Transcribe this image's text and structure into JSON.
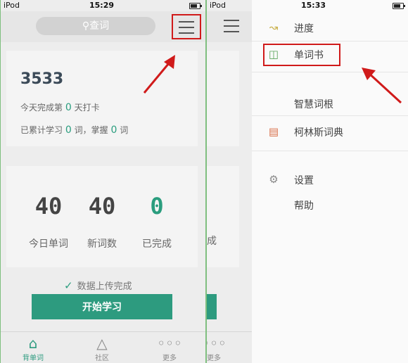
{
  "screens": {
    "main": {
      "status": {
        "left": "iPod",
        "time": "15:29"
      },
      "search": {
        "placeholder": "查词"
      },
      "card1": {
        "total": "3533",
        "streak_prefix": "今天完成第",
        "streak_days": "0",
        "streak_suffix": "天打卡",
        "learned_prefix": "已累计学习",
        "learned_count": "0",
        "learned_unit": "词，掌握",
        "mastered_count": "0",
        "mastered_unit": "词"
      },
      "stats": [
        {
          "value": "40",
          "label": "今日单词"
        },
        {
          "value": "40",
          "label": "新词数"
        },
        {
          "value": "0",
          "label": "已完成"
        }
      ],
      "upload_text": "数据上传完成",
      "start_button": "开始学习",
      "tabs": [
        {
          "label": "背单词",
          "icon": "home-icon"
        },
        {
          "label": "社区",
          "icon": "community-icon"
        },
        {
          "label": "更多",
          "icon": "more-icon"
        }
      ]
    },
    "mid": {
      "status": {
        "left": "iPod"
      },
      "stat_label": "成",
      "tab_label": "更多"
    },
    "menu": {
      "status": {
        "time": "15:33"
      },
      "items": [
        {
          "label": "进度",
          "icon": "progress-icon"
        },
        {
          "label": "单词书",
          "icon": "book-icon"
        },
        {
          "label": "智慧词根",
          "icon": "root-icon"
        },
        {
          "label": "柯林斯词典",
          "icon": "dictionary-icon"
        },
        {
          "label": "设置",
          "icon": "gear-icon"
        },
        {
          "label": "帮助",
          "icon": "help-icon"
        }
      ]
    }
  },
  "colors": {
    "accent": "#2d9b7f",
    "annotation": "#d01a1a"
  }
}
